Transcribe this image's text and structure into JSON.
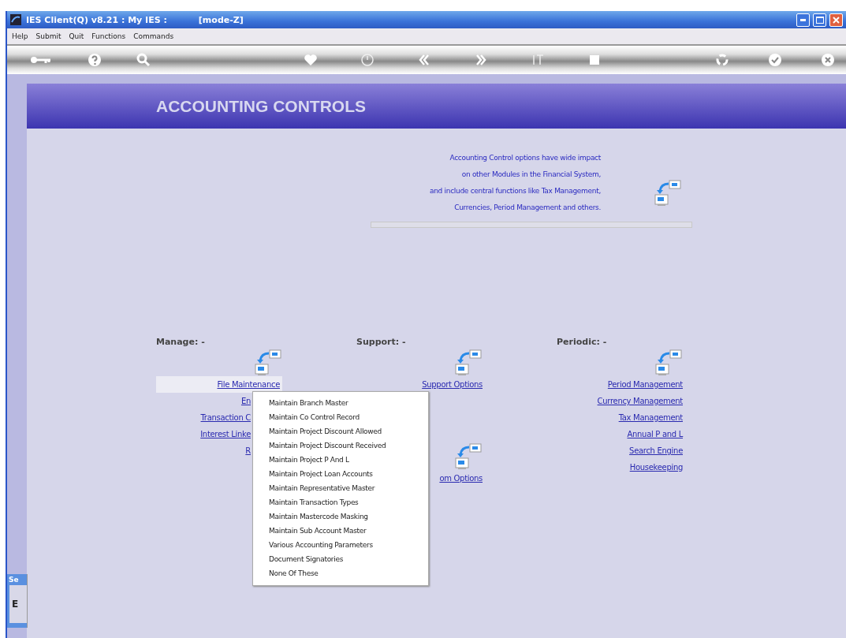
{
  "window": {
    "title": "IES Client(Q) v8.21 : My IES :",
    "mode": "[mode-Z]"
  },
  "menu_bar": [
    "Help",
    "Submit",
    "Quit",
    "Functions",
    "Commands"
  ],
  "header": {
    "title": "ACCOUNTING CONTROLS"
  },
  "description": [
    "Accounting Control options have wide impact",
    "on other Modules in the Financial System,",
    "and include central functions like Tax Management,",
    "Currencies, Period Management and others."
  ],
  "progress": {
    "level": 0
  },
  "sections": [
    {
      "heading": "Manage: -",
      "groups": [
        {
          "links": [
            {
              "label": "File Maintenance",
              "selected": true
            },
            {
              "label": "En",
              "selected": false
            },
            {
              "label": "Transaction C",
              "selected": false
            },
            {
              "label": "Interest Linke",
              "selected": false
            },
            {
              "label": "R",
              "selected": false
            }
          ]
        }
      ]
    },
    {
      "heading": "Support: -",
      "groups": [
        {
          "links": [
            {
              "label": "Support Options",
              "selected": false
            }
          ]
        },
        {
          "links": [
            {
              "label": "om Options",
              "selected": false
            }
          ]
        }
      ]
    },
    {
      "heading": "Periodic: -",
      "groups": [
        {
          "links": [
            {
              "label": "Period Management",
              "selected": false
            },
            {
              "label": "Currency Management",
              "selected": false
            },
            {
              "label": "Tax Management",
              "selected": false
            },
            {
              "label": "Annual P and L",
              "selected": false
            },
            {
              "label": "Search Engine",
              "selected": false
            },
            {
              "label": "Housekeeping",
              "selected": false
            }
          ]
        }
      ]
    }
  ],
  "popup_menu": [
    "Maintain Branch Master",
    "Maintain Co Control Record",
    "Maintain Project Discount Allowed",
    "Maintain Project Discount Received",
    "Maintain Project P And L",
    "Maintain Project Loan Accounts",
    "Maintain Representative Master",
    "Maintain Transaction Types",
    "Maintain Mastercode Masking",
    "Maintain Sub Account Master",
    "Various Accounting Parameters",
    "Document Signatories",
    "None Of These"
  ],
  "side_window": {
    "title": "Se",
    "content": "E"
  }
}
